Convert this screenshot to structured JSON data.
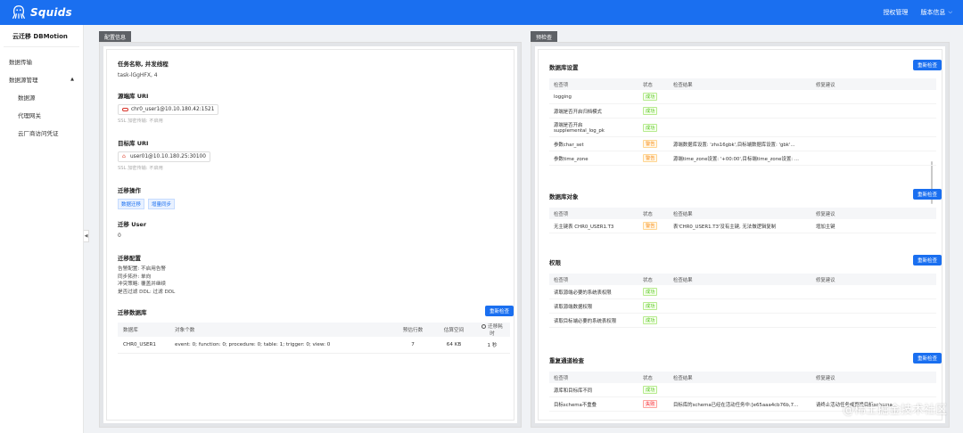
{
  "app": {
    "name": "Squids",
    "logo_icon": "octopus-icon"
  },
  "topnav": {
    "license": "授权管理",
    "version": "版本信息"
  },
  "sidebar": {
    "title": "云迁移 DBMotion",
    "items": [
      {
        "label": "数据传输"
      },
      {
        "label": "数据源管理"
      },
      {
        "label": "数据源"
      },
      {
        "label": "代理网关"
      },
      {
        "label": "云厂商访问凭证"
      }
    ]
  },
  "left_panel": {
    "tab": "配置信息",
    "task_label": "任务名称, 并发线程",
    "task_value": "task-lGgHFX, 4",
    "source_label": "源端库 URI",
    "source_uri": "chr0_user1@10.10.180.42:1521",
    "source_ssl": "SSL 加密传输: 不启用",
    "target_label": "目标库 URI",
    "target_uri": "user01@10.10.180.25:30100",
    "target_ssl": "SSL 加密传输: 不启用",
    "ops_label": "迁移操作",
    "ops_tags": [
      "数据迁移",
      "增量同步"
    ],
    "user_label": "迁移 User",
    "user_value": "0",
    "config_label": "迁移配置",
    "config_lines": [
      "告警配置: 不启用告警",
      "同步拓扑: 单向",
      "冲突策略: 覆盖并继续",
      "是否过滤 DDL: 过滤 DDL"
    ],
    "db_label": "迁移数据库",
    "recheck": "重新检查",
    "table": {
      "headers": [
        "数据库",
        "对象个数",
        "预估行数",
        "估算空间",
        "迁移耗时"
      ],
      "rows": [
        [
          "CHR0_USER1",
          "event: 0; function: 0; procedure: 0; table: 1; trigger: 0; view: 0",
          "7",
          "64 KB",
          "1 秒"
        ]
      ]
    }
  },
  "right_panel": {
    "tab": "预检查",
    "headers": [
      "检查项",
      "状态",
      "检查结果",
      "修复建议"
    ],
    "recheck": "重新检查",
    "sections": [
      {
        "title": "数据库设置",
        "rows": [
          [
            "logging",
            "成功",
            "",
            ""
          ],
          [
            "源端是否开启归档模式",
            "成功",
            "",
            ""
          ],
          [
            "源端是否开启 supplemental_log_pk",
            "成功",
            "",
            ""
          ],
          [
            "参数char_set",
            "警告",
            "源端数据库设置: 'zhs16gbk',目标端数据库设置: 'gbk'...",
            ""
          ],
          [
            "参数time_zone",
            "警告",
            "源端time_zone设置: '+00:00',目标端time_zone设置: ...",
            ""
          ]
        ]
      },
      {
        "title": "数据库对象",
        "rows": [
          [
            "无主键表 CHR0_USER1.T3",
            "警告",
            "表'CHR0_USER1.T3'没有主键, 无法做逻辑复制",
            "增加主键"
          ]
        ]
      },
      {
        "title": "权限",
        "rows": [
          [
            "读取源端必要的系统表权限",
            "成功",
            "",
            ""
          ],
          [
            "读取源端数据权限",
            "成功",
            "",
            ""
          ],
          [
            "读取目标端必要的系统表权限",
            "成功",
            "",
            ""
          ]
        ]
      },
      {
        "title": "重复通道检查",
        "rows": [
          [
            "源库和目标库不同",
            "成功",
            "",
            ""
          ],
          [
            "目标schema不重叠",
            "失败",
            "目标库的schema已经在活动任务中:[e65aaa4cb76b,7...",
            "请终止活动任务或更换目标schema"
          ]
        ]
      }
    ]
  },
  "watermark": "@稀土掘金技术社区"
}
